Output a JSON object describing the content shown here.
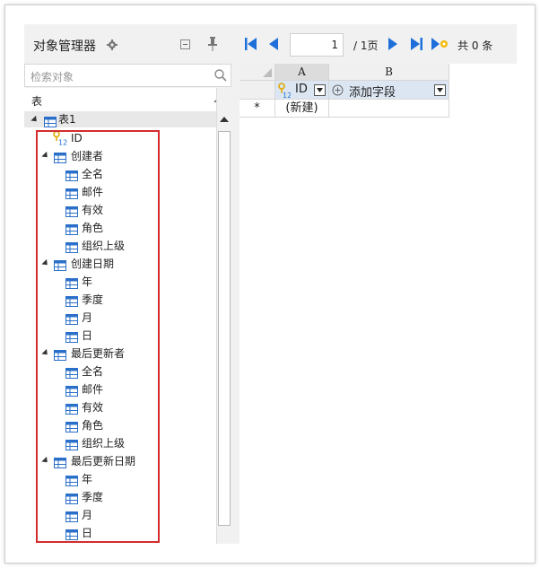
{
  "object_manager": {
    "title": "对象管理器",
    "search_placeholder": "检索对象",
    "section_label": "表"
  },
  "tree": {
    "root": "表1",
    "id_field": "ID",
    "groups": [
      {
        "label": "创建者",
        "children": [
          "全名",
          "邮件",
          "有效",
          "角色",
          "组织上级"
        ]
      },
      {
        "label": "创建日期",
        "children": [
          "年",
          "季度",
          "月",
          "日"
        ]
      },
      {
        "label": "最后更新者",
        "children": [
          "全名",
          "邮件",
          "有效",
          "角色",
          "组织上级"
        ]
      },
      {
        "label": "最后更新日期",
        "children": [
          "年",
          "季度",
          "月",
          "日"
        ]
      }
    ]
  },
  "pager": {
    "current_page": "1",
    "total_pages_text": "/ 1页",
    "total_count_text": "共 0 条"
  },
  "grid": {
    "col_a": "A",
    "col_b": "B",
    "id_header": "ID",
    "add_field": "添加字段",
    "new_row_marker": "*",
    "new_row_text": "(新建)"
  },
  "colors": {
    "accent_blue": "#1e6fd9",
    "highlight_red": "#d42c2c",
    "key_gold": "#e0a800"
  }
}
